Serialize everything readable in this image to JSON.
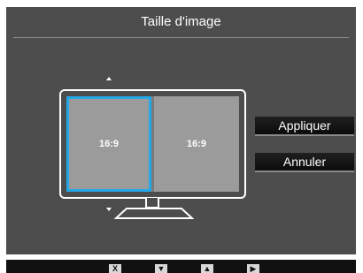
{
  "osd": {
    "title": "Taille d'image"
  },
  "preview": {
    "left_panel_label": "16:9",
    "right_panel_label": "16:9",
    "selected_panel": "left"
  },
  "buttons": {
    "apply_label": "Appliquer",
    "cancel_label": "Annuler"
  },
  "keys": {
    "close": "X",
    "down": "▼",
    "up": "▲",
    "enter": "▶"
  },
  "colors": {
    "osd_background": "#4d4d4d",
    "selection_accent": "#23a8e8",
    "button_background": "#111111",
    "panel_fill": "#9b9b9b"
  }
}
